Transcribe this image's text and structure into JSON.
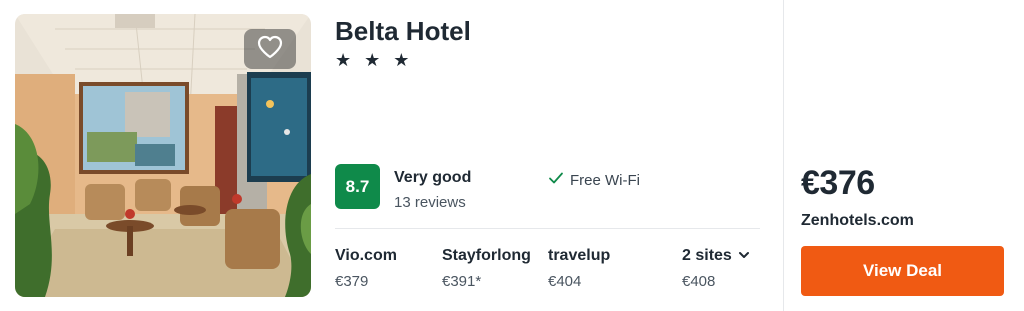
{
  "hotel": {
    "name": "Belta Hotel",
    "stars": "★ ★ ★",
    "score": "8.7",
    "rating_word": "Very good",
    "reviews": "13 reviews",
    "amenity": "Free Wi-Fi"
  },
  "sites": [
    {
      "name": "Vio.com",
      "price": "€379"
    },
    {
      "name": "Stayforlong",
      "price": "€391*"
    },
    {
      "name": "travelup",
      "price": "€404"
    }
  ],
  "more_sites": {
    "label": "2 sites",
    "price": "€408"
  },
  "deal": {
    "price": "€376",
    "provider": "Zenhotels.com",
    "button_label": "View Deal"
  },
  "colors": {
    "score_bg": "#0f8a4a",
    "deal_button": "#f05a13"
  },
  "icons": [
    "heart-icon",
    "check-icon",
    "chevron-down-icon"
  ]
}
